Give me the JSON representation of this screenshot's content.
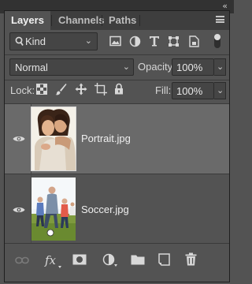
{
  "window": {
    "collapse_label": "«"
  },
  "tabs": [
    {
      "label": "Layers",
      "active": true
    },
    {
      "label": "Channels",
      "active": false
    },
    {
      "label": "Paths",
      "active": false
    }
  ],
  "filter": {
    "kind_label": "Kind",
    "filter_icons": [
      "pixel-filter-icon",
      "adjustment-filter-icon",
      "type-filter-icon",
      "shape-filter-icon",
      "smart-object-filter-icon"
    ]
  },
  "blend": {
    "mode": "Normal",
    "opacity_label": "Opacity:",
    "opacity_value": "100%"
  },
  "lock": {
    "label": "Lock:",
    "icons": [
      "lock-transparent-pixels-icon",
      "lock-image-pixels-icon",
      "lock-position-icon",
      "lock-artboard-icon",
      "lock-all-icon"
    ],
    "fill_label": "Fill:",
    "fill_value": "100%"
  },
  "layers": [
    {
      "name": "Portrait.jpg",
      "visible": true,
      "selected": true
    },
    {
      "name": "Soccer.jpg",
      "visible": true,
      "selected": false
    }
  ],
  "bottom_icons": [
    "link-layers-icon",
    "fx-icon",
    "add-mask-icon",
    "adjustment-layer-icon",
    "new-group-icon",
    "new-layer-icon",
    "delete-layer-icon"
  ],
  "colors": {
    "panel_bg": "#535353",
    "selected_row": "#6a6a6a",
    "tab_bar": "#3e3e3e"
  }
}
